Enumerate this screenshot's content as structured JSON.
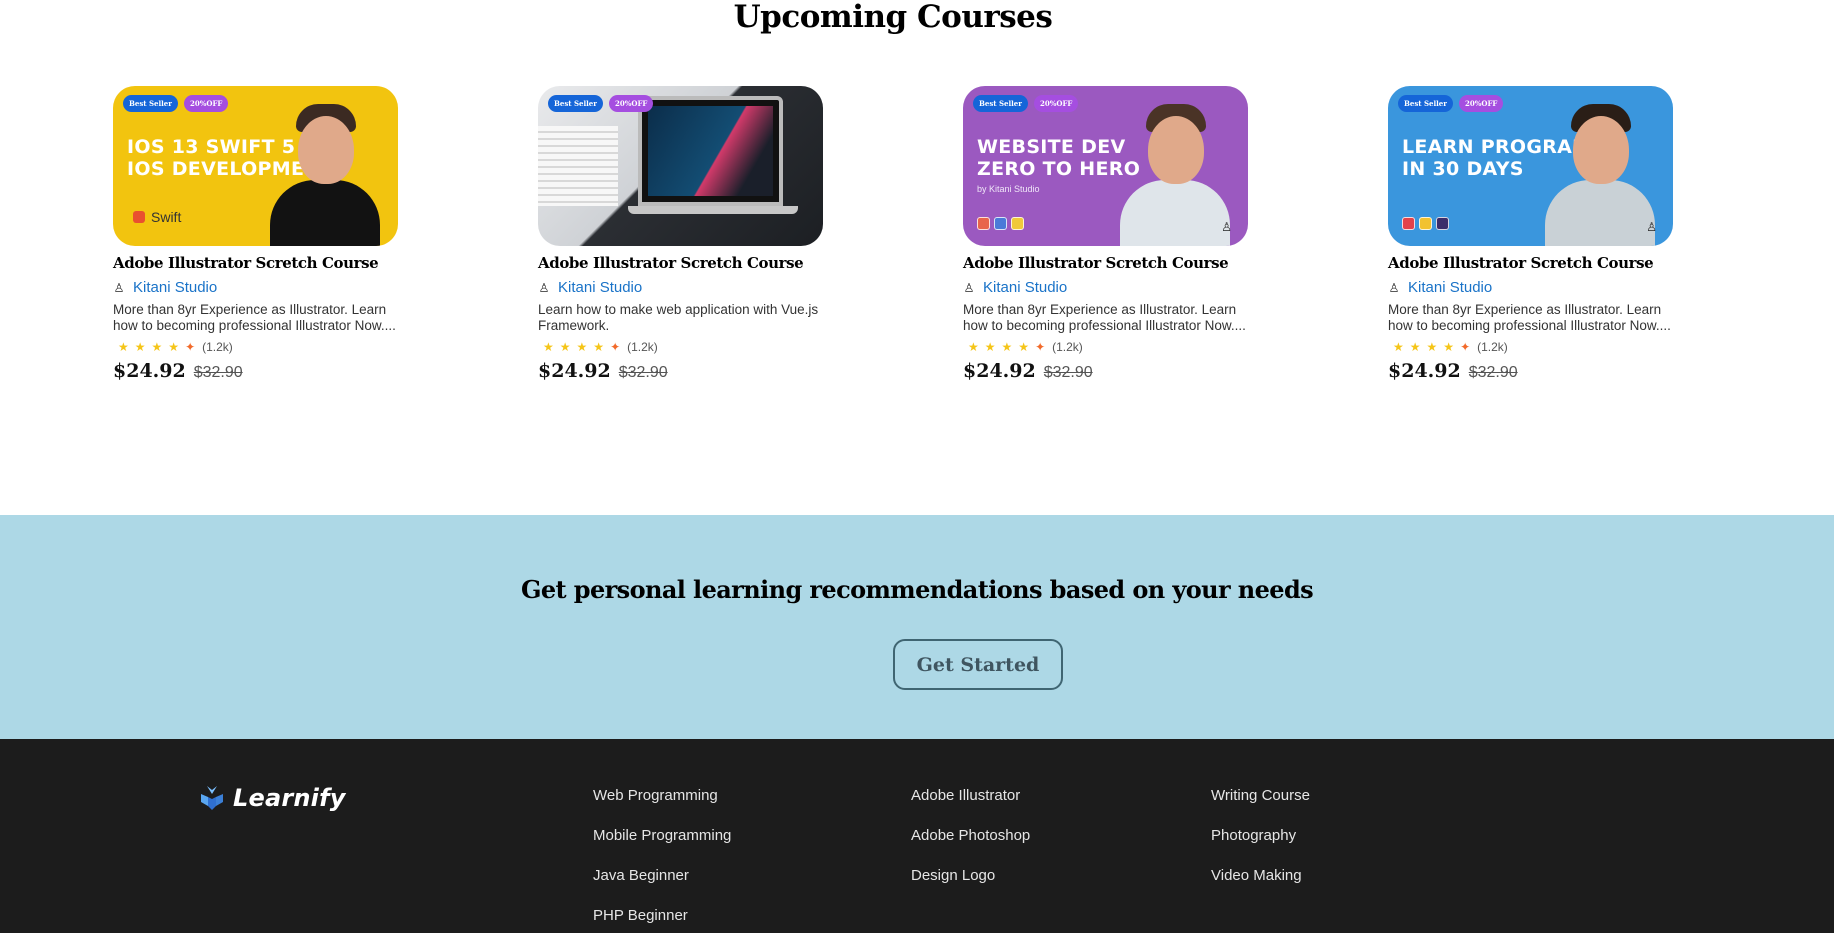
{
  "section": {
    "title": "Upcoming Courses"
  },
  "courses": [
    {
      "badge_primary": "Best Seller",
      "badge_discount": "20%OFF",
      "thumb_heading": "IOS 13 SWIFT 5\nIOS DEVELOPMEN",
      "thumb_tag": "Swift",
      "title": "Adobe Illustrator Scretch Course",
      "author": "Kitani Studio",
      "description": "More than 8yr Experience as Illustrator. Learn how to becoming professional Illustrator Now....",
      "rating_count": "(1.2k)",
      "price": "$24.92",
      "old_price": "$32.90"
    },
    {
      "badge_primary": "Best Seller",
      "badge_discount": "20%OFF",
      "title": "Adobe Illustrator Scretch Course",
      "author": "Kitani Studio",
      "description": "Learn how to make web application with Vue.js Framework.",
      "rating_count": "(1.2k)",
      "price": "$24.92",
      "old_price": "$32.90"
    },
    {
      "badge_primary": "Best Seller",
      "badge_discount": "20%OFF",
      "thumb_heading": "WEBSITE DEV\nZERO TO HERO",
      "thumb_sub": "by Kitani Studio",
      "title": "Adobe Illustrator Scretch Course",
      "author": "Kitani Studio",
      "description": "More than 8yr Experience as Illustrator. Learn how to becoming professional Illustrator Now....",
      "rating_count": "(1.2k)",
      "price": "$24.92",
      "old_price": "$32.90"
    },
    {
      "badge_primary": "Best Seller",
      "badge_discount": "20%OFF",
      "thumb_heading": "LEARN PROGRAMI\nIN 30 DAYS",
      "title": "Adobe Illustrator Scretch Course",
      "author": "Kitani Studio",
      "description": "More than 8yr Experience as Illustrator. Learn how to becoming professional Illustrator Now....",
      "rating_count": "(1.2k)",
      "price": "$24.92",
      "old_price": "$32.90"
    }
  ],
  "cta": {
    "title": "Get personal learning recommendations based on your needs",
    "button_label": "Get Started"
  },
  "footer": {
    "brand": "Learnify",
    "columns": [
      [
        "Web Programming",
        "Mobile Programming",
        "Java Beginner",
        "PHP Beginner"
      ],
      [
        "Adobe Illustrator",
        "Adobe Photoshop",
        "Design Logo"
      ],
      [
        "Writing Course",
        "Photography",
        "Video Making"
      ]
    ]
  },
  "colors": {
    "cta_bg": "#add8e6",
    "footer_bg": "#1c1c1c",
    "link_blue": "#1a73c8",
    "badge_blue": "#1565d8",
    "badge_purple": "#a54ee0",
    "star": "#f5c518"
  },
  "icons": {
    "author": "user-icon",
    "star": "star-icon",
    "logo": "learnify-logo-icon"
  }
}
